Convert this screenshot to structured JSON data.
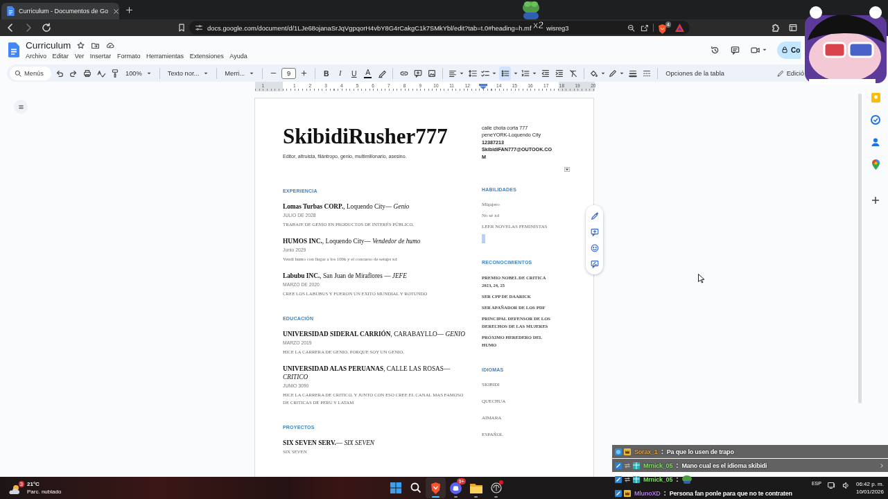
{
  "tabs": [
    {
      "title": "Curriculum - Documentos de Go",
      "selected": true
    }
  ],
  "address_bar": {
    "url": "docs.google.com/document/d/1LJe68ojanaSrJqVgpqorH4vbY8G4rCakgC1k7SMkYbl/edit?tab=t.0#heading=h.mf",
    "url_tail": "wisreg3",
    "shield_badge": "4"
  },
  "emote_overlay": {
    "count": "x2"
  },
  "document_header": {
    "title": "Curriculum",
    "menus": [
      "Archivo",
      "Editar",
      "Ver",
      "Insertar",
      "Formato",
      "Herramientas",
      "Extensiones",
      "Ayuda"
    ],
    "share_button": "Co"
  },
  "toolbar": {
    "search": {
      "placeholder": "Menús"
    },
    "zoom": "100%",
    "style": "Texto nor...",
    "font": "Merri...",
    "font_size": "9",
    "format_buttons": [
      {
        "label": "B",
        "kind": "bold"
      },
      {
        "label": "I",
        "kind": "italic"
      },
      {
        "label": "U",
        "kind": "underline"
      },
      {
        "label": "A",
        "kind": "color"
      }
    ],
    "bulleted_list": {
      "selected": true
    },
    "table_options": "Opciones de la tabla",
    "mode": "Edició"
  },
  "ruler": {
    "items": [
      {
        "kind": "number",
        "text": "1"
      },
      {
        "kind": "margin"
      },
      {
        "kind": "number",
        "text": "1"
      },
      {
        "kind": "number",
        "text": "2"
      },
      {
        "kind": "number",
        "text": "3"
      },
      {
        "kind": "number",
        "text": "4"
      },
      {
        "kind": "number",
        "text": "5"
      },
      {
        "kind": "number",
        "text": "6"
      },
      {
        "kind": "number",
        "text": "7"
      },
      {
        "kind": "number",
        "text": "8"
      },
      {
        "kind": "number",
        "text": "9"
      },
      {
        "kind": "number",
        "text": "10"
      },
      {
        "kind": "number",
        "text": "11"
      },
      {
        "kind": "number",
        "text": "12"
      },
      {
        "kind": "indent-marker"
      },
      {
        "kind": "number",
        "text": "14"
      },
      {
        "kind": "number",
        "text": "15"
      },
      {
        "kind": "number",
        "text": "16"
      },
      {
        "kind": "number",
        "text": "17"
      },
      {
        "kind": "number",
        "text": "18"
      },
      {
        "kind": "number",
        "text": "19"
      },
      {
        "kind": "number",
        "text": "20"
      }
    ]
  },
  "document": {
    "name": "SkibidiRusher777",
    "tagline": "Editor, altruista, filántropo, genio, multimillonario, asesino.",
    "contact": [
      {
        "text": "calle chota corta 777",
        "bold": false
      },
      {
        "text": "peneYORK-Loquendo City",
        "bold": false
      },
      {
        "text": "12387213",
        "bold": true
      },
      {
        "text": "SkibidiFAN777@OUTOOK.COM",
        "bold": true
      }
    ],
    "main_sections": [
      {
        "heading": "EXPERIENCIA",
        "entries": [
          {
            "title": "**Lomas Turbas CORP.**, Loquendo City— *Genio*",
            "date": "JULIO DE 2028",
            "description": "TRABAJE DE GENIO EN PRODUCTOS DE INTERÉS PÚBLICO,"
          },
          {
            "title": "**HUMOS INC.**, Loquendo City— *Vendedor de humo*",
            "date": "Junio 2029",
            "description": "Vendí humo con llegar a los 100k y el concurso de setups xd"
          },
          {
            "title": "**Labubu INC.**, San Juan de Miraflores — *JEFE*",
            "date": "MARZO DE 2020",
            "description": "CREE LOS LABUBUS Y FUERON UN EXITO MUNDIAL Y ROTUNDO"
          }
        ]
      },
      {
        "heading": "EDUCACIÓN",
        "entries": [
          {
            "title": "**UNIVERSIDAD SIDERAL CARRIÓN**, CARABAYLLO— *GENIO*",
            "date": "MARZO 2019",
            "description": "HICE LA CARRERA DE GENIO, PORQUE SOY UN GENIO,"
          },
          {
            "title": "**UNIVERSIDAD ALAS PERUANAS**, CALLE LAS ROSAS— *CRITICO*",
            "date": "JUNIO 3090",
            "description": "HICE LA CARRERA DE CRITICO, Y JUNTO CON ESO CREE EL CANAL MAS FAMOSO DE CRITICAS DE PERU Y LATAM"
          }
        ]
      },
      {
        "heading": "PROYECTOS",
        "entries": [
          {
            "title": "**SIX SEVEN SERV.**— *SIX SEVEN*",
            "description": "SIX SEVEN"
          }
        ]
      }
    ],
    "side_sections": [
      {
        "heading": "HABILIDADES",
        "kind": "skills",
        "selected_empty_line": true,
        "items": [
          "Migajero",
          "No sé xd",
          "LEER NOVELAS FEMINISTAS"
        ]
      },
      {
        "heading": "RECONOCIMIENTOS",
        "kind": "awards",
        "items": [
          "PREMIO NOBEL DE CRITICA 2023, 24, 25",
          "SER CPP DE DAARICK",
          "SER APAÑADOR DE LOS PDF",
          "PRINCIPAL DEFENSOR DE LOS DERECHOS DE LAS MUJERES",
          "PRÓXIMO HEREDERO DEL HUMO"
        ]
      },
      {
        "heading": "IDIOMAS",
        "kind": "languages",
        "items": [
          "SKIBIDI",
          "QUECHUA",
          "AIMARA",
          "ESPAÑOL"
        ]
      }
    ]
  },
  "chat": [
    {
      "user": "Sorax_1",
      "color": "#e8a33a",
      "separator": ":",
      "kind": "text",
      "text": "Pa que lo usen de trapo",
      "badges": [
        {
          "kind": "cube"
        },
        {
          "kind": "crown"
        }
      ]
    },
    {
      "user": "Mrnick_05",
      "color": "#86e26b",
      "separator": ":",
      "kind": "text",
      "text": "Mano cual es el idioma skibidi",
      "badges": [
        {
          "kind": "tool"
        },
        {
          "kind": "swap"
        },
        {
          "kind": "gift"
        }
      ],
      "expandable": true
    },
    {
      "user": "Mrnick_05",
      "color": "#86e26b",
      "separator": ":",
      "kind": "emote",
      "badges": [
        {
          "kind": "tool"
        },
        {
          "kind": "swap"
        },
        {
          "kind": "gift"
        }
      ]
    },
    {
      "user": "MlunoXD",
      "color": "#b57be8",
      "separator": ":",
      "kind": "text",
      "text": "Persona fan ponle para que no te contraten",
      "badges": [
        {
          "kind": "tool"
        },
        {
          "kind": "crown"
        }
      ]
    }
  ],
  "taskbar": {
    "weather": {
      "temp": "21°C",
      "condition": "Parc. nublado",
      "badge": "3"
    },
    "apps": [
      {
        "kind": "start",
        "selected": false,
        "open": false,
        "alert": false
      },
      {
        "kind": "search",
        "selected": false,
        "open": false,
        "alert": false
      },
      {
        "kind": "browser",
        "selected": true,
        "open": true,
        "alert": false
      },
      {
        "kind": "chat",
        "selected": false,
        "open": true,
        "alert": false,
        "badge": "9+"
      },
      {
        "kind": "files",
        "selected": false,
        "open": true,
        "alert": false
      },
      {
        "kind": "app",
        "selected": false,
        "open": true,
        "alert": true
      }
    ],
    "tray": {
      "language": "ESP",
      "time": "06:42 p. m.",
      "date": "10/01/2026"
    }
  }
}
